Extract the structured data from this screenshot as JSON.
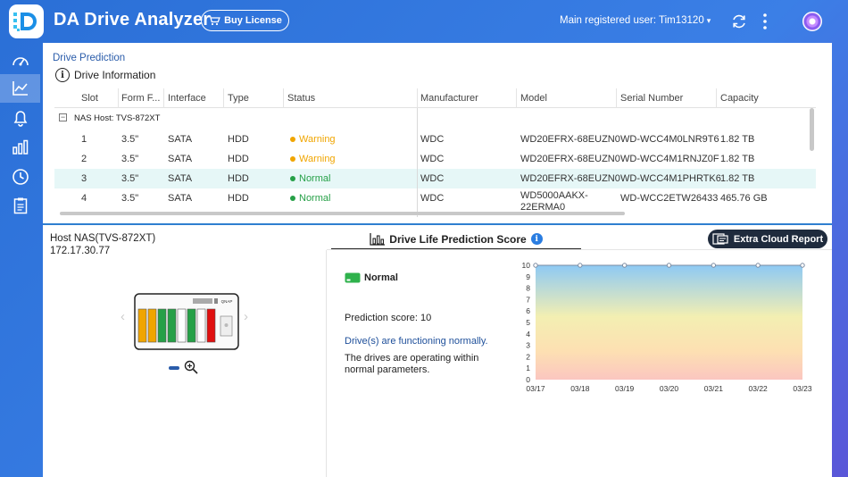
{
  "header": {
    "app_title": "DA Drive Analyzer",
    "buy_license_label": "Buy License",
    "user_label": "Main registered user: Tim13120",
    "caret": "▾"
  },
  "breadcrumb": "Drive Prediction",
  "section_title": "Drive Information",
  "table": {
    "columns": [
      "Slot",
      "Form F...",
      "Interface",
      "Type",
      "Status",
      "Manufacturer",
      "Model",
      "Serial Number",
      "Capacity"
    ],
    "group_label": "NAS Host: TVS-872XT",
    "rows": [
      {
        "slot": "1",
        "form": "3.5\"",
        "interface": "SATA",
        "type": "HDD",
        "status": "Warning",
        "manufacturer": "WDC",
        "model": "WD20EFRX-68EUZN0",
        "model2": "",
        "serial": "WD-WCC4M0LNR9T6",
        "capacity": "1.82 TB"
      },
      {
        "slot": "2",
        "form": "3.5\"",
        "interface": "SATA",
        "type": "HDD",
        "status": "Warning",
        "manufacturer": "WDC",
        "model": "WD20EFRX-68EUZN0",
        "model2": "",
        "serial": "WD-WCC4M1RNJZ0F",
        "capacity": "1.82 TB"
      },
      {
        "slot": "3",
        "form": "3.5\"",
        "interface": "SATA",
        "type": "HDD",
        "status": "Normal",
        "manufacturer": "WDC",
        "model": "WD20EFRX-68EUZN0",
        "model2": "",
        "serial": "WD-WCC4M1PHRTK6",
        "capacity": "1.82 TB"
      },
      {
        "slot": "4",
        "form": "3.5\"",
        "interface": "SATA",
        "type": "HDD",
        "status": "Normal",
        "manufacturer": "WDC",
        "model": "WD5000AAKX-",
        "model2": "22ERMA0",
        "serial": "WD-WCC2ETW26433",
        "capacity": "465.76 GB"
      }
    ]
  },
  "host": {
    "title": "Host NAS(TVS-872XT)",
    "ip": "172.17.30.77",
    "nas_brand": "QNAP"
  },
  "prediction": {
    "tab_label": "Drive Life Prediction Score",
    "cloud_button_label": "Extra Cloud Report",
    "status": "Normal",
    "score_text": "Prediction score: 10",
    "functioning_msg": "Drive(s) are functioning normally.",
    "description": "The drives are operating within normal parameters."
  },
  "colors": {
    "warning": "#f0a500",
    "normal": "#26a047",
    "accent": "#2a7de1"
  },
  "icons": {
    "logo": "da-logo-icon",
    "sidebar": [
      "dashboard-icon",
      "chart-line-icon",
      "bell-icon",
      "bar-chart-icon",
      "clock-icon",
      "clipboard-icon"
    ]
  },
  "chart_data": {
    "type": "area",
    "x": [
      "03/17",
      "03/18",
      "03/19",
      "03/20",
      "03/21",
      "03/22",
      "03/23"
    ],
    "values": [
      10,
      10,
      10,
      10,
      10,
      10,
      10
    ],
    "ylim": [
      0,
      10
    ],
    "yticks": [
      0,
      1,
      2,
      3,
      4,
      5,
      6,
      7,
      8,
      9,
      10
    ],
    "title": "",
    "xlabel": "",
    "ylabel": "",
    "grid": false
  }
}
